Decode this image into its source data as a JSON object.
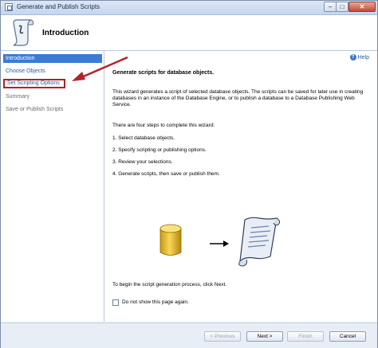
{
  "window": {
    "title": "Generate and Publish Scripts"
  },
  "header": {
    "page_title": "Introduction"
  },
  "nav": {
    "items": [
      {
        "label": "Introduction"
      },
      {
        "label": "Choose Objects"
      },
      {
        "label": "Set Scripting Options"
      },
      {
        "label": "Summary"
      },
      {
        "label": "Save or Publish Scripts"
      }
    ]
  },
  "content": {
    "help": "Help",
    "heading": "Generate scripts for database objects.",
    "description": "This wizard generates a script of selected database objects. The scripts can be saved for later use in creating databases in an instance of the Database Engine, or to publish a database to a Database Publishing Web Service.",
    "steps_intro": "There are four steps to complete this wizard:",
    "steps": [
      "1. Select database objects.",
      "2. Specify scripting or publishing options.",
      "3. Review your selections.",
      "4. Generate scripts, then save or publish them."
    ],
    "begin_text": "To begin the script generation process, click Next.",
    "checkbox_label": "Do not show this page again."
  },
  "footer": {
    "previous": "< Previous",
    "next": "Next >",
    "finish": "Finish",
    "cancel": "Cancel"
  },
  "colors": {
    "active_nav": "#3b7bd4",
    "highlight_box": "#b0232b",
    "link": "#2a5ca8"
  },
  "icons": [
    "scroll-icon",
    "database-icon",
    "right-arrow-icon",
    "script-scroll-icon",
    "help-icon"
  ]
}
